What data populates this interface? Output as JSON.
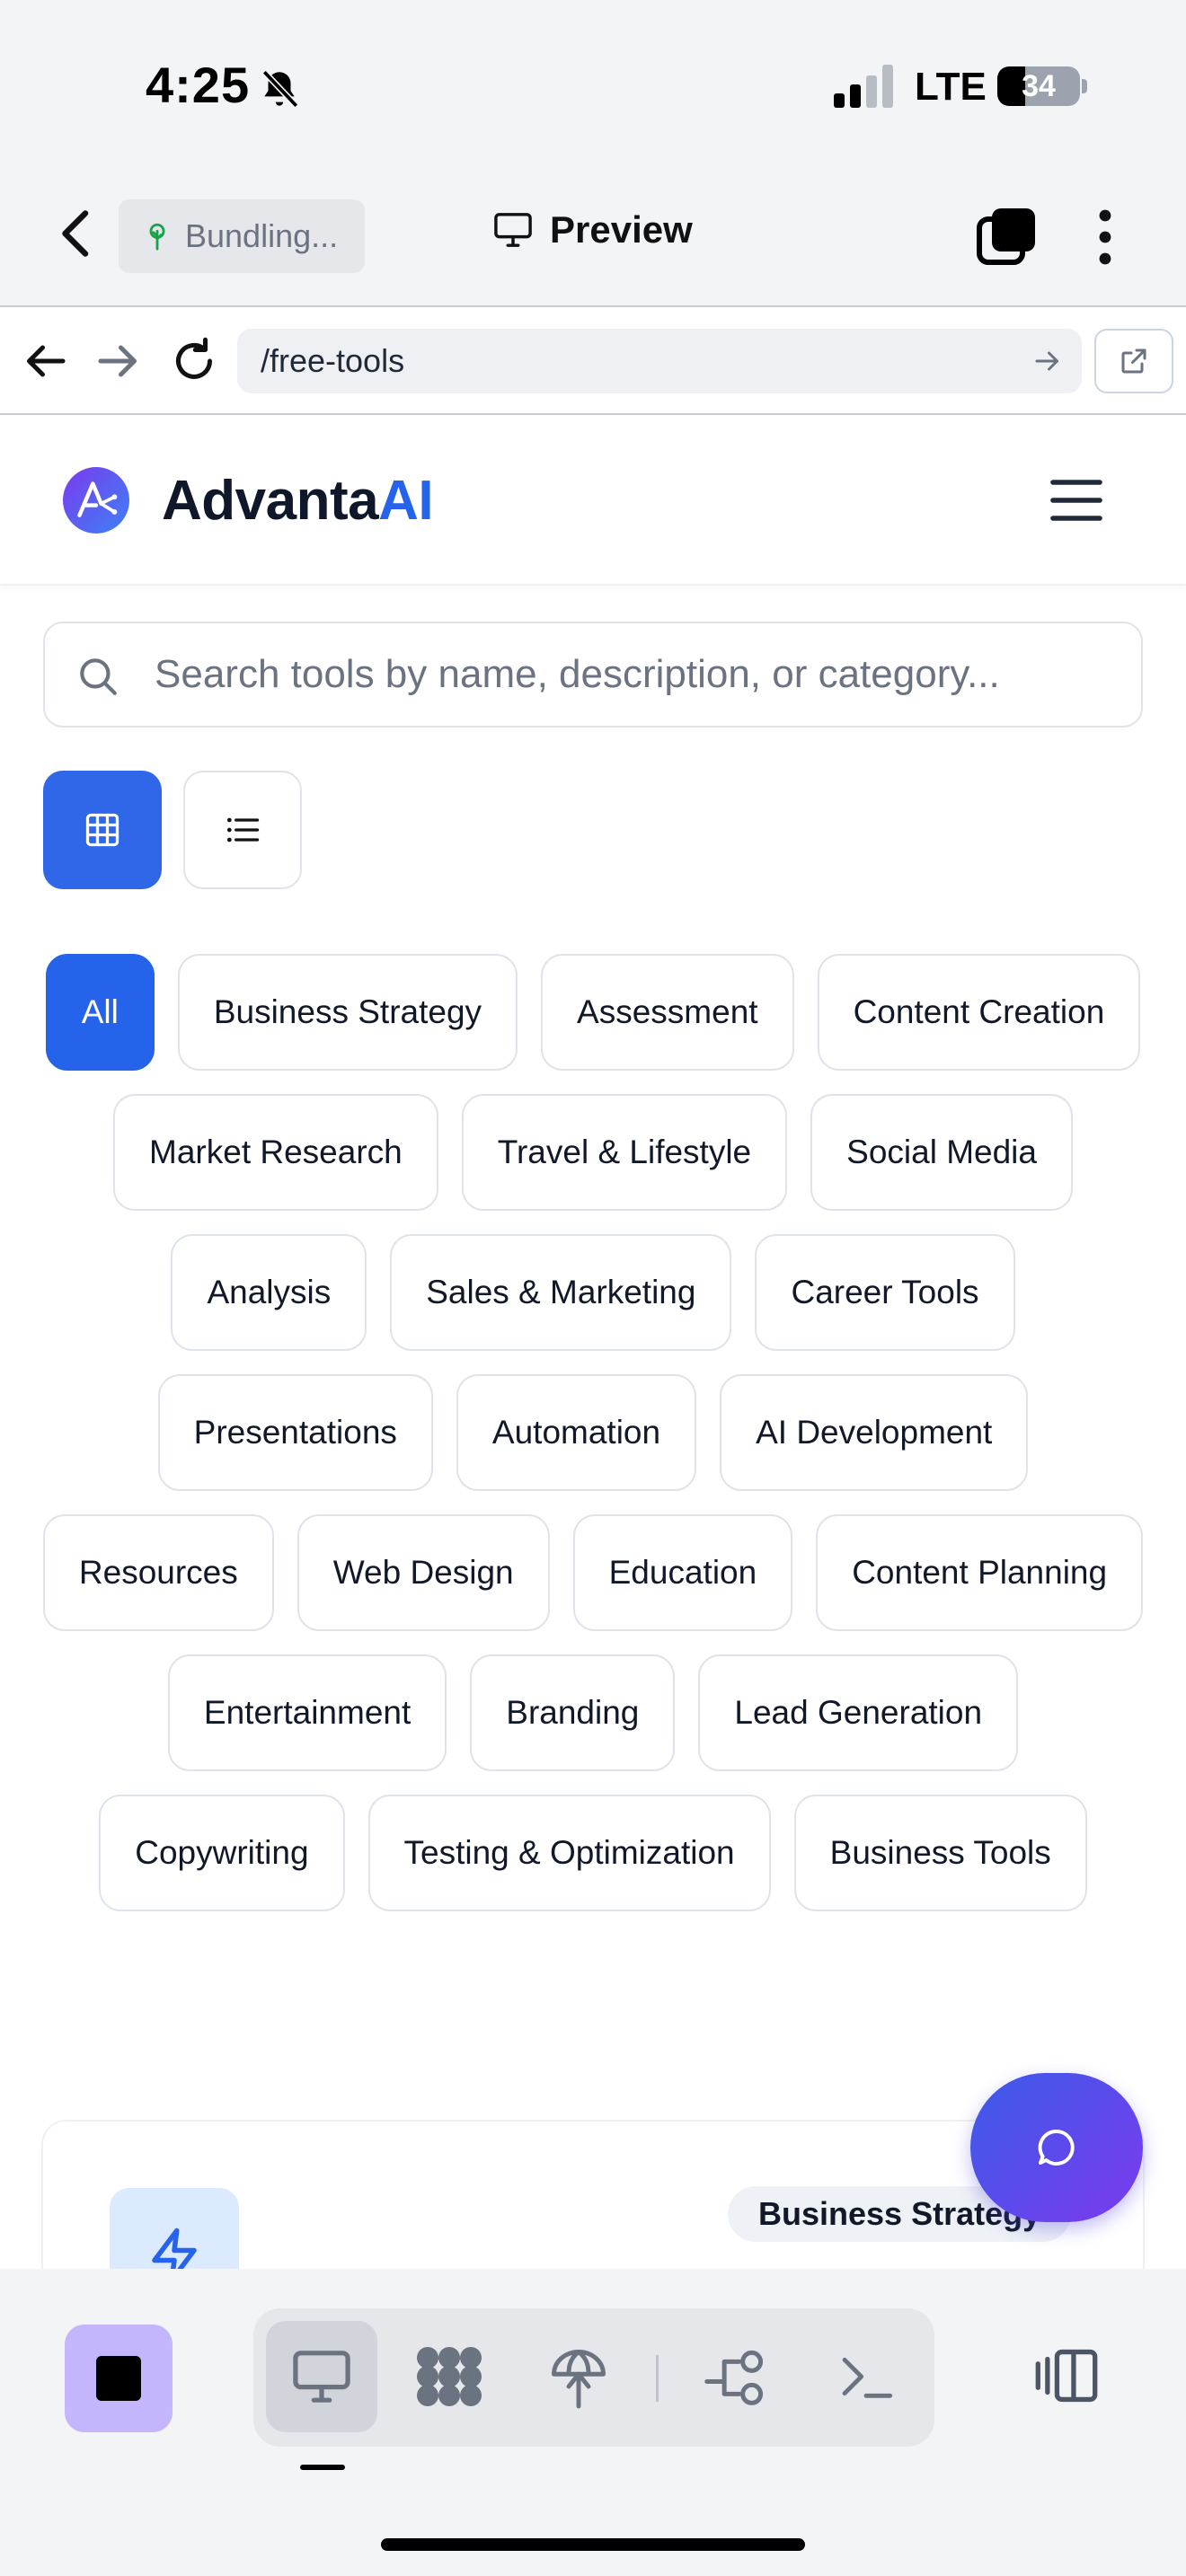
{
  "status_bar": {
    "time": "4:25",
    "network": "LTE",
    "battery": "34",
    "battery_level": 0.34
  },
  "app_header": {
    "bundling_label": "Bundling...",
    "preview_label": "Preview"
  },
  "browser": {
    "url": "/free-tools"
  },
  "site": {
    "logo_primary": "Advanta",
    "logo_accent": "AI"
  },
  "search": {
    "placeholder": "Search tools by name, description, or category..."
  },
  "view_toggle": {
    "active": "grid"
  },
  "categories": [
    {
      "label": "All",
      "active": true
    },
    {
      "label": "Business Strategy"
    },
    {
      "label": "Assessment"
    },
    {
      "label": "Content Creation"
    },
    {
      "label": "Market Research"
    },
    {
      "label": "Travel & Lifestyle"
    },
    {
      "label": "Social Media"
    },
    {
      "label": "Analysis"
    },
    {
      "label": "Sales & Marketing"
    },
    {
      "label": "Career Tools"
    },
    {
      "label": "Presentations"
    },
    {
      "label": "Automation"
    },
    {
      "label": "AI Development"
    },
    {
      "label": "Resources"
    },
    {
      "label": "Web Design"
    },
    {
      "label": "Education"
    },
    {
      "label": "Content Planning"
    },
    {
      "label": "Entertainment"
    },
    {
      "label": "Branding"
    },
    {
      "label": "Lead Generation"
    },
    {
      "label": "Copywriting"
    },
    {
      "label": "Testing & Optimization"
    },
    {
      "label": "Business Tools"
    }
  ],
  "card": {
    "badge": "Business Strategy",
    "icon": "lightning-icon"
  },
  "colors": {
    "accent": "#2563eb",
    "fab_start": "#3b5bea",
    "fab_end": "#7c3aed",
    "stop_bg": "#c4b5fd"
  },
  "toolbar": {
    "icons": [
      "stop-icon",
      "monitor-icon",
      "components-icon",
      "deploy-icon",
      "git-branch-icon",
      "terminal-icon",
      "panel-toggle-icon"
    ]
  }
}
